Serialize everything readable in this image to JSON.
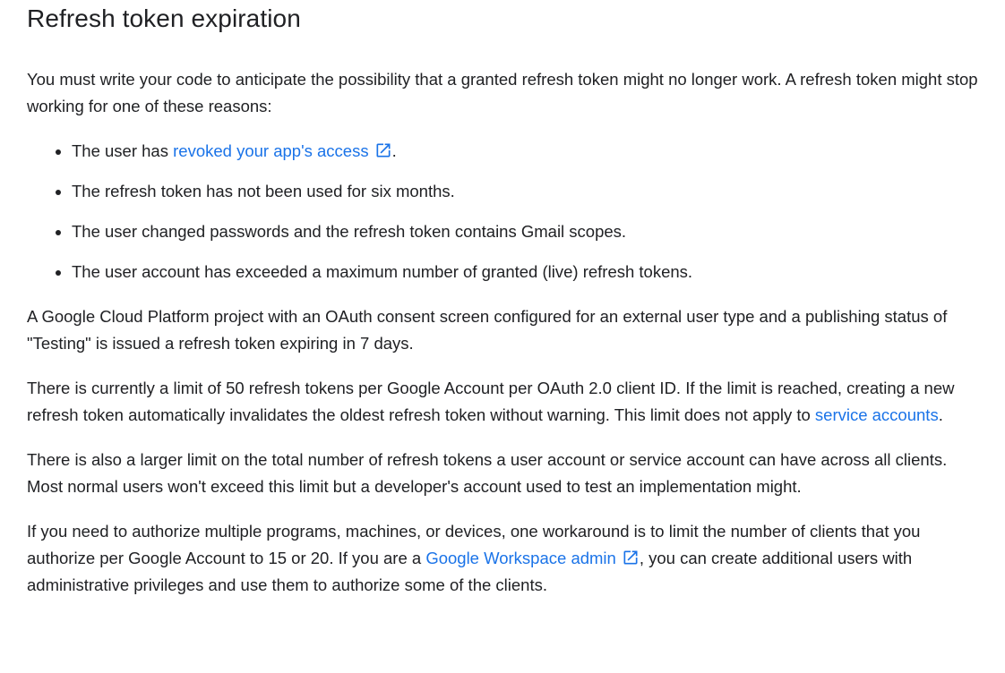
{
  "heading": "Refresh token expiration",
  "intro": "You must write your code to anticipate the possibility that a granted refresh token might no longer work. A refresh token might stop working for one of these reasons:",
  "reasons": [
    {
      "prefix": "The user has ",
      "link_text": "revoked your app's access",
      "link_icon": "external-link-icon",
      "suffix": "."
    },
    {
      "text": "The refresh token has not been used for six months."
    },
    {
      "text": "The user changed passwords and the refresh token contains Gmail scopes."
    },
    {
      "text": "The user account has exceeded a maximum number of granted (live) refresh tokens."
    }
  ],
  "para_testing": "A Google Cloud Platform project with an OAuth consent screen configured for an external user type and a publishing status of \"Testing\" is issued a refresh token expiring in 7 days.",
  "para_limit": {
    "text": "There is currently a limit of 50 refresh tokens per Google Account per OAuth 2.0 client ID. If the limit is reached, creating a new refresh token automatically invalidates the oldest refresh token without warning. This limit does not apply to ",
    "link_text": "service accounts",
    "suffix": "."
  },
  "para_larger_limit": "There is also a larger limit on the total number of refresh tokens a user account or service account can have across all clients. Most normal users won't exceed this limit but a developer's account used to test an implementation might.",
  "para_workaround": {
    "text": "If you need to authorize multiple programs, machines, or devices, one workaround is to limit the number of clients that you authorize per Google Account to 15 or 20. If you are a ",
    "link_text": "Google Workspace admin",
    "link_icon": "external-link-icon",
    "suffix": ", you can create additional users with administrative privileges and use them to authorize some of the clients."
  },
  "colors": {
    "text": "#202124",
    "link": "#1a73e8"
  }
}
